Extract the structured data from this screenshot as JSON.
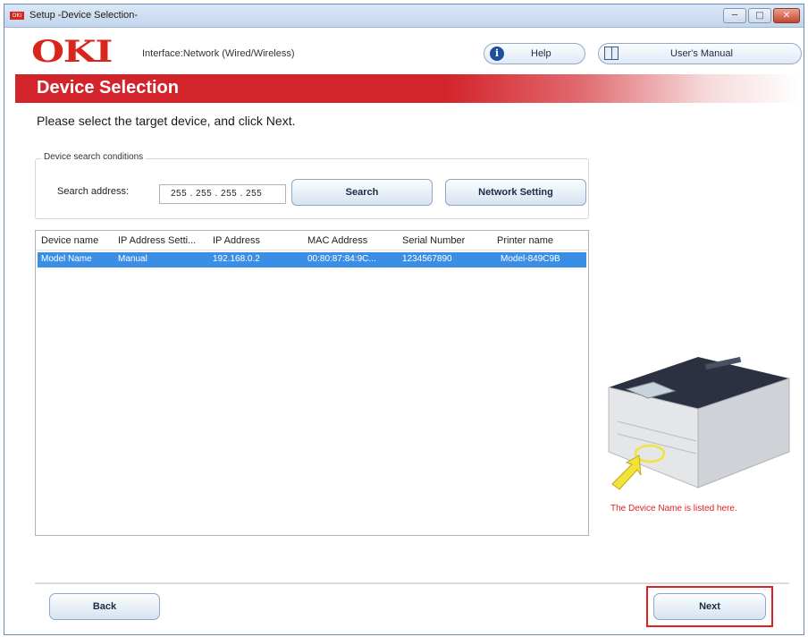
{
  "window": {
    "title": "Setup -Device Selection-",
    "controls": [
      "minimize",
      "maximize",
      "close"
    ]
  },
  "header": {
    "logo": "OKI",
    "interface_text": "Interface:Network (Wired/Wireless)",
    "help_label": "Help",
    "manual_label": "User's Manual"
  },
  "banner": {
    "title": "Device Selection"
  },
  "instruction": "Please select the target device, and click Next.",
  "search_conditions": {
    "legend": "Device search conditions",
    "address_label": "Search address:",
    "address_value": "255 . 255 . 255 . 255",
    "search_button": "Search",
    "network_setting_button": "Network Setting"
  },
  "device_list": {
    "columns": [
      "Device name",
      "IP Address Setti...",
      "IP Address",
      "MAC Address",
      "Serial Number",
      "Printer name"
    ],
    "rows": [
      [
        "Model Name",
        "Manual",
        "192.168.0.2",
        "00:80:87:84:9C...",
        "1234567890",
        "Model-849C9B"
      ]
    ],
    "selected_row": 0
  },
  "illustration": {
    "caption": "The Device Name is listed here.",
    "arrow_color": "#f2e23a"
  },
  "footer": {
    "back_label": "Back",
    "next_label": "Next"
  },
  "colors": {
    "brand_red": "#d4242b",
    "selection_blue": "#3a8ee6",
    "highlight_red": "#e02020"
  }
}
